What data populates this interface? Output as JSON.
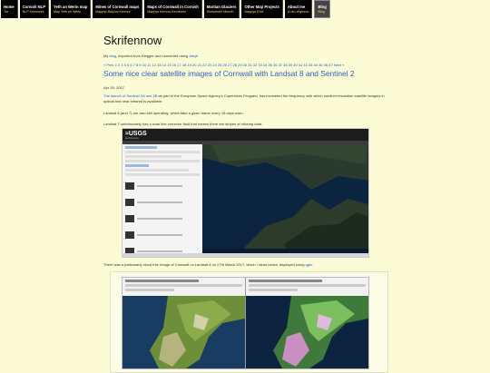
{
  "nav": [
    {
      "title": "Home",
      "sub": "Tre",
      "active": false
    },
    {
      "title": "Cornish NLP",
      "sub": "NLP Kernewek",
      "active": false
    },
    {
      "title": "Yeth an Werin map",
      "sub": "Map Yeth an Werin",
      "active": false
    },
    {
      "title": "Mines of Cornwall maps",
      "sub": "Mappys Balyow Kernow",
      "active": false
    },
    {
      "title": "Maps of Cornwall in Cornish",
      "sub": "Mappys Kernow Kernewek",
      "active": false
    },
    {
      "title": "Martian Glaciers",
      "sub": "Reeveneth Meurth",
      "active": false
    },
    {
      "title": "Other Map Projects",
      "sub": "Mappys Erell",
      "active": false
    },
    {
      "title": "About me",
      "sub": "A-dro dhymmo",
      "active": false
    },
    {
      "title": "Blog",
      "sub": "Blog",
      "active": true
    }
  ],
  "site_title": "Skrifennow",
  "intro": {
    "pre": "My ",
    "blog_link": "blog",
    "mid": ", imported from Blogger and converted using ",
    "jekyll_link": "Jekyll",
    "post": "."
  },
  "pager": {
    "prev": "« Prev",
    "pages_before": "1 2 3 4 5 6 7 8 9 10 11 12",
    "current": "13",
    "pages_after": "14 15 16 17 18 19 20 21 22 23 24 25 26 27 28 29 30 31 32 33 34 35 36 37 38 39 40 41 42 43 44 45 46 47",
    "next": "Next »"
  },
  "post": {
    "title": "Some nice clear satellite images of Cornwall with Landsat 8 and Sentinel 2",
    "date": "Apr 29, 2017",
    "p1_link": "The launch of Sentinel 2A and 2B",
    "p1_rest": " as part of the European Space Agency's Copernicus Program, has increased the frequency with which medium resolution satellite imagery in optical and near infrared is available.",
    "p2": "Landsat 8 (and 7) are also still operating, which take a given frame every 16 days each.",
    "p3": "Landsat 7 unfortunately has a scan line corrector fault that means there are stripes of missing data.",
    "p4_pre": "There was a particularly cloud free image of Cornwall on Landsat 8 on 27th March 2017, which I show below, displayed using ",
    "p4_link": "qgis",
    "p4_post": "."
  },
  "screenshot1": {
    "logo": "≈USGS",
    "subtitle": "EarthExplorer"
  },
  "colors": {
    "background": "#fbfbd5",
    "nav_bg": "#000000",
    "nav_sub": "#ffcf6a",
    "link": "#1a5ecf",
    "post_title": "#2a60c8"
  }
}
